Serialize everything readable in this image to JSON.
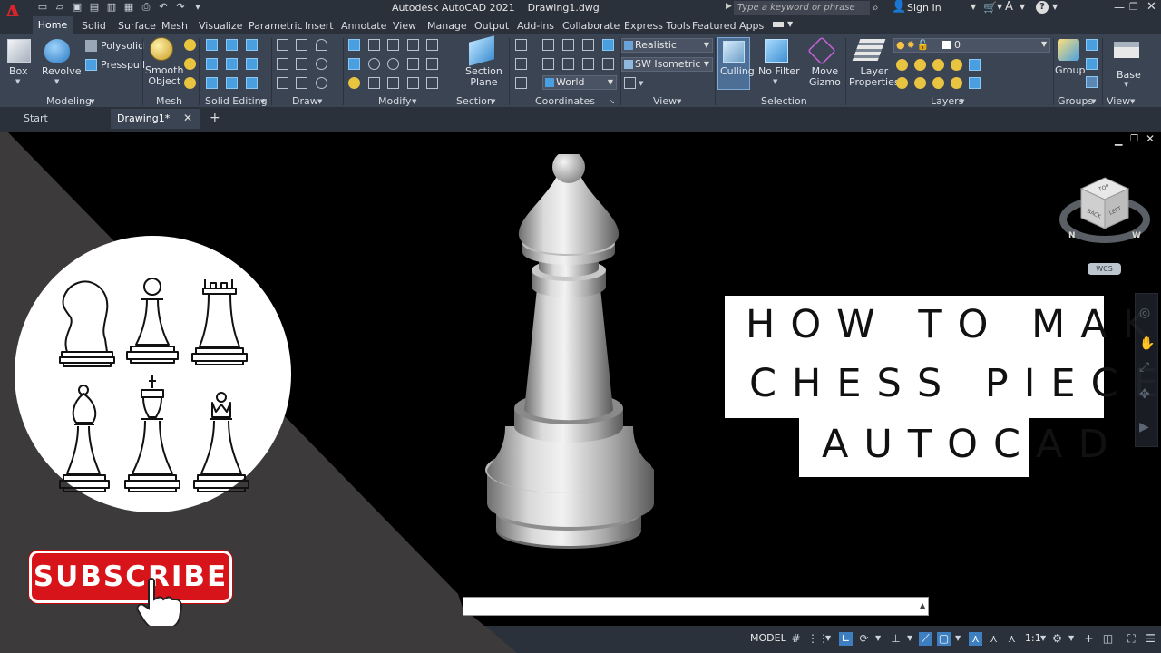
{
  "titlebar": {
    "app_logo": "A",
    "title": "Autodesk AutoCAD 2021    Drawing1.dwg",
    "search_placeholder": "Type a keyword or phrase",
    "sign_in": "Sign In",
    "quick_access_icons": [
      "new-icon",
      "open-icon",
      "save-icon",
      "save-as-icon",
      "web-open-icon",
      "web-save-icon",
      "plot-icon",
      "undo-icon",
      "redo-icon",
      "customize-icon"
    ]
  },
  "ribbon_tabs": [
    "Home",
    "Solid",
    "Surface",
    "Mesh",
    "Visualize",
    "Parametric",
    "Insert",
    "Annotate",
    "View",
    "Manage",
    "Output",
    "Add-ins",
    "Collaborate",
    "Express Tools",
    "Featured Apps"
  ],
  "ribbon": {
    "modeling": {
      "title": "Modeling",
      "box": "Box",
      "revolve": "Revolve",
      "polysolid": "Polysolid",
      "presspull": "Presspull"
    },
    "mesh": {
      "title": "Mesh",
      "smooth_object": "Smooth\nObject"
    },
    "solid_editing": {
      "title": "Solid Editing"
    },
    "draw": {
      "title": "Draw"
    },
    "modify": {
      "title": "Modify"
    },
    "section": {
      "title": "Section",
      "section_plane": "Section\nPlane"
    },
    "coordinates": {
      "title": "Coordinates",
      "ucs": "World"
    },
    "view": {
      "title": "View",
      "visual_style": "Realistic",
      "view_direction": "SW Isometric"
    },
    "selection": {
      "title": "Selection",
      "culling": "Culling",
      "no_filter": "No Filter",
      "move_gizmo": "Move\nGizmo"
    },
    "layers": {
      "title": "Layers",
      "layer_properties": "Layer\nProperties",
      "current_layer": "0"
    },
    "groups": {
      "title": "Groups",
      "group": "Group"
    },
    "view2": {
      "title": "View",
      "base": "Base"
    }
  },
  "file_tabs": {
    "start": "Start",
    "drawing": "Drawing1*"
  },
  "thumbnail": {
    "title_lines": [
      "HOW TO MAKE A",
      "CHESS PIECE IN",
      "AUTOCAD"
    ],
    "subscribe": "SUBSCRIBE"
  },
  "viewcube": {
    "wcs": "WCS",
    "faces": [
      "TOP",
      "BACK",
      "LEFT"
    ],
    "compass": [
      "N",
      "W"
    ]
  },
  "statusbar": {
    "model": "MODEL",
    "scale": "1:1"
  },
  "colors": {
    "ribbon_bg": "#3b4453",
    "titlebar_bg": "#2b313b",
    "viewport_bg": "#000000",
    "wedge_gray": "#3c3a3a",
    "subscribe_red": "#d7141a",
    "accent_blue": "#3e7fc2"
  }
}
